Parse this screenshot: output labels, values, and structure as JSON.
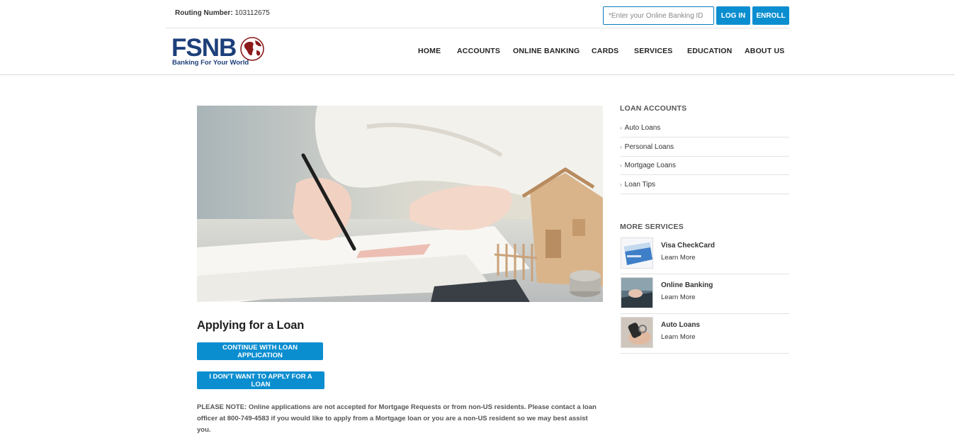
{
  "topbar": {
    "routing_label": "Routing Number:",
    "routing_value": "103112675",
    "login_placeholder": "*Enter your Online Banking ID",
    "login_label": "LOG IN",
    "enroll_label": "ENROLL"
  },
  "logo": {
    "name": "FSNB",
    "tagline": "Banking For Your World"
  },
  "nav": [
    "HOME",
    "ACCOUNTS",
    "ONLINE BANKING",
    "CARDS",
    "SERVICES",
    "EDUCATION",
    "ABOUT US"
  ],
  "main": {
    "title": "Applying for a Loan",
    "continue_label": "CONTINUE WITH LOAN APPLICATION",
    "decline_label": "I DON'T WANT TO APPLY FOR A LOAN",
    "note": "PLEASE NOTE: Online applications are not accepted for Mortgage Requests or from non-US residents. Please contact a loan officer at 800-749-4583 if you would like to apply from a Mortgage loan or you are a non-US resident so we may best assist you."
  },
  "sidebar": {
    "loan_title": "LOAN ACCOUNTS",
    "loan_links": [
      "Auto Loans",
      "Personal Loans",
      "Mortgage Loans",
      "Loan Tips"
    ],
    "services_title": "MORE SERVICES",
    "services": [
      {
        "name": "Visa CheckCard",
        "more": "Learn More"
      },
      {
        "name": "Online Banking",
        "more": "Learn More"
      },
      {
        "name": "Auto Loans",
        "more": "Learn More"
      }
    ]
  },
  "colors": {
    "accent": "#0b8ed0",
    "brand_navy": "#1d3f7a",
    "brand_red": "#8b1a1a"
  }
}
